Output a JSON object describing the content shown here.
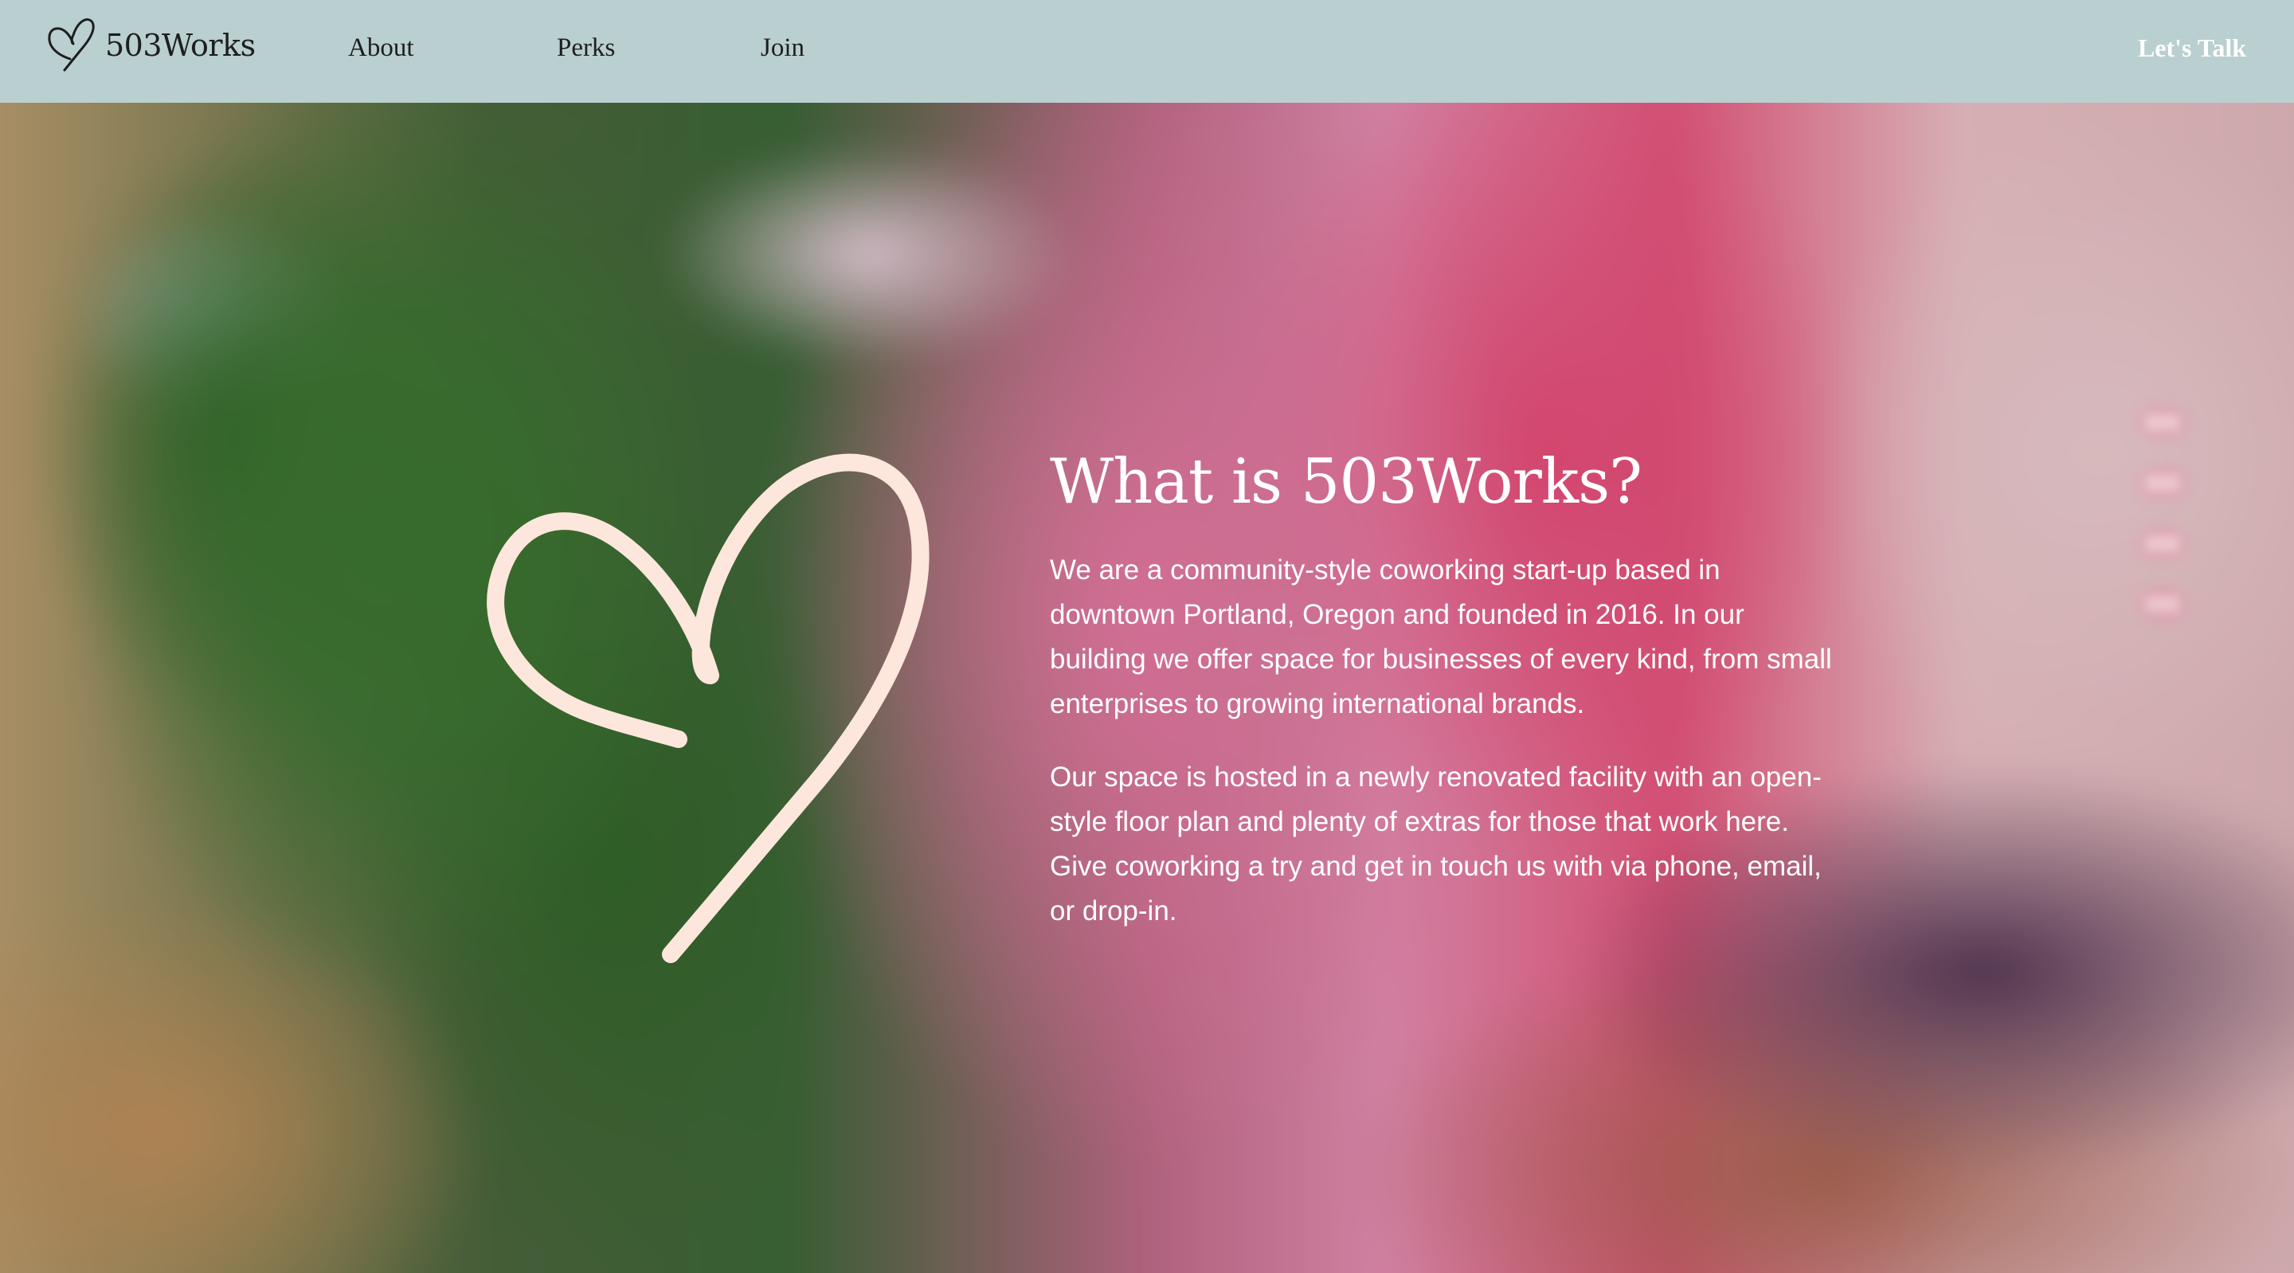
{
  "nav": {
    "brand": "503Works",
    "links": [
      "About",
      "Perks",
      "Join"
    ],
    "cta": "Let's Talk"
  },
  "hero": {
    "title": "What is 503Works?",
    "paragraphs": [
      "We are a community-style coworking start-up based in downtown Portland, Oregon and founded in 2016. In our building we offer space for businesses of every kind, from small enterprises to growing international brands.",
      "Our space is hosted in a newly renovated facility with an open-style floor plan and plenty of extras for those that work here. Give coworking a try and get in touch us with via phone, email, or drop-in."
    ]
  },
  "colors": {
    "navbar_bg": "#bacfcf",
    "nav_text": "#1e1e1e",
    "cta_text": "#ffffff",
    "heart_stroke": "#fde6dc",
    "hero_text": "#ffffff"
  },
  "icons": {
    "brand": "heart-icon",
    "hero_illustration": "heart-icon"
  }
}
